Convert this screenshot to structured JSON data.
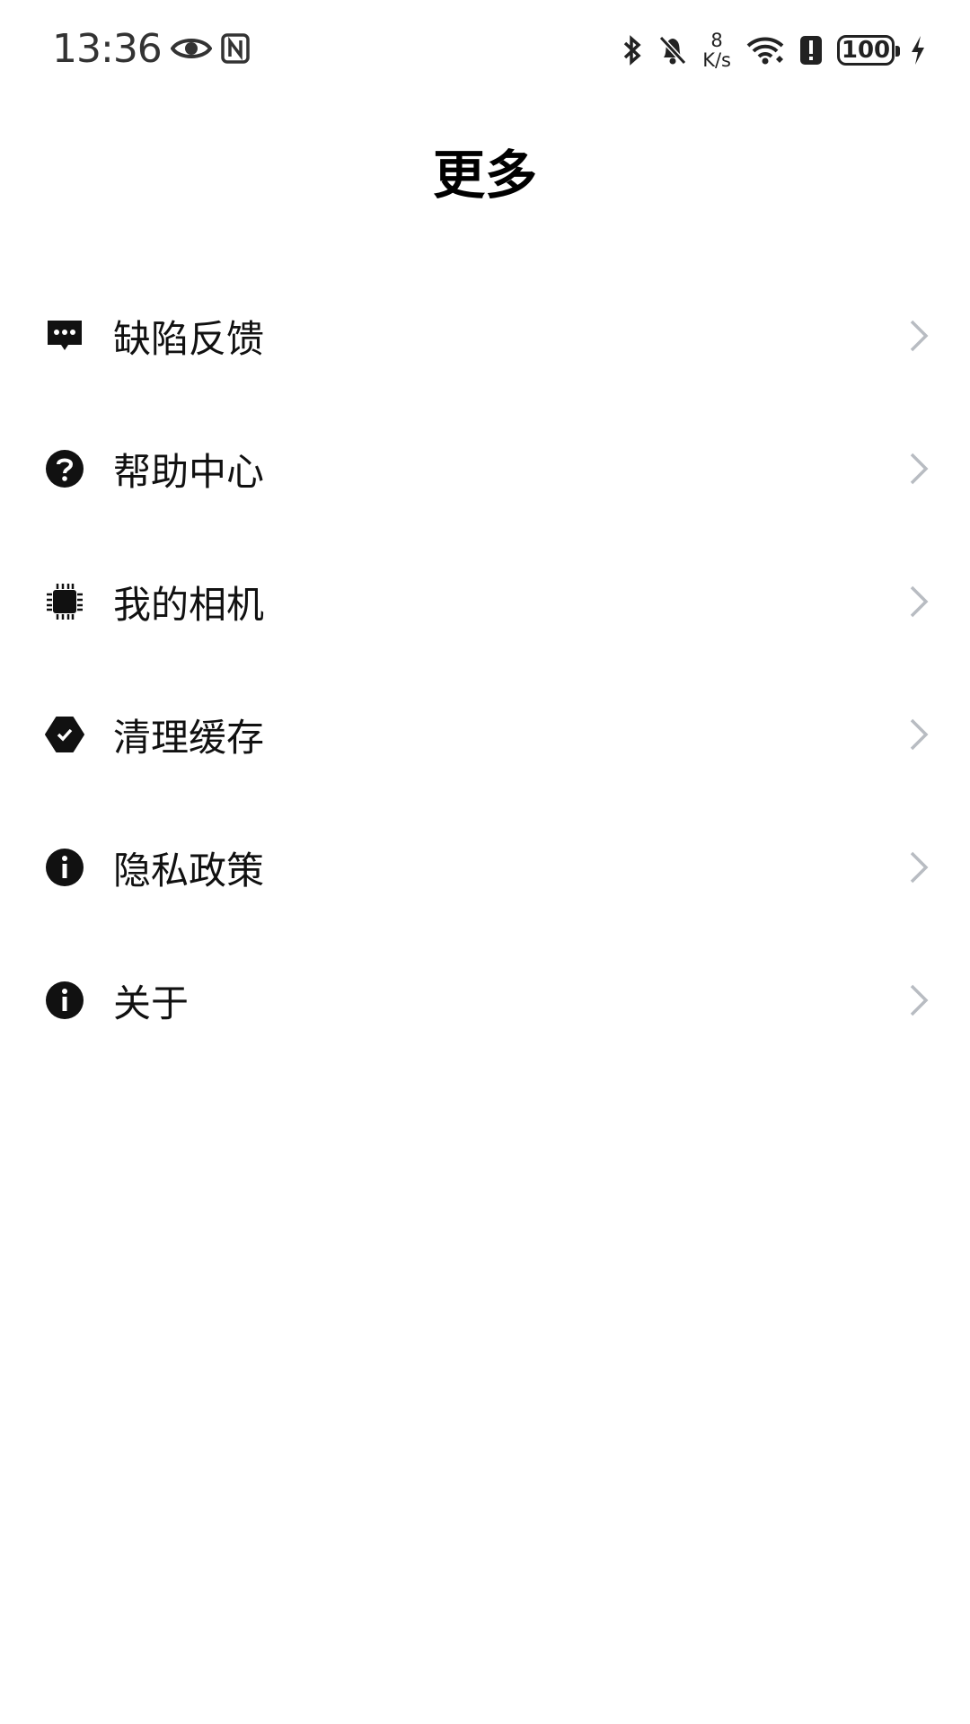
{
  "status_bar": {
    "time": "13:36",
    "net_speed_value": "8",
    "net_speed_unit": "K/s",
    "battery": "100",
    "left_icons": [
      "eye-icon",
      "nfc-icon"
    ],
    "right_icons": [
      "bluetooth-icon",
      "bell-off-icon",
      "wifi-icon",
      "alert-icon",
      "battery-icon",
      "charging-bolt-icon"
    ]
  },
  "header": {
    "title": "更多"
  },
  "menu": {
    "items": [
      {
        "label": "缺陷反馈",
        "icon": "feedback-message-icon"
      },
      {
        "label": "帮助中心",
        "icon": "help-circle-icon"
      },
      {
        "label": "我的相机",
        "icon": "chip-icon"
      },
      {
        "label": "清理缓存",
        "icon": "clean-check-icon"
      },
      {
        "label": "隐私政策",
        "icon": "info-icon"
      },
      {
        "label": "关于",
        "icon": "info-icon"
      }
    ]
  },
  "colors": {
    "background": "#ffffff",
    "text": "#111111",
    "chevron": "#b8bcc2"
  }
}
